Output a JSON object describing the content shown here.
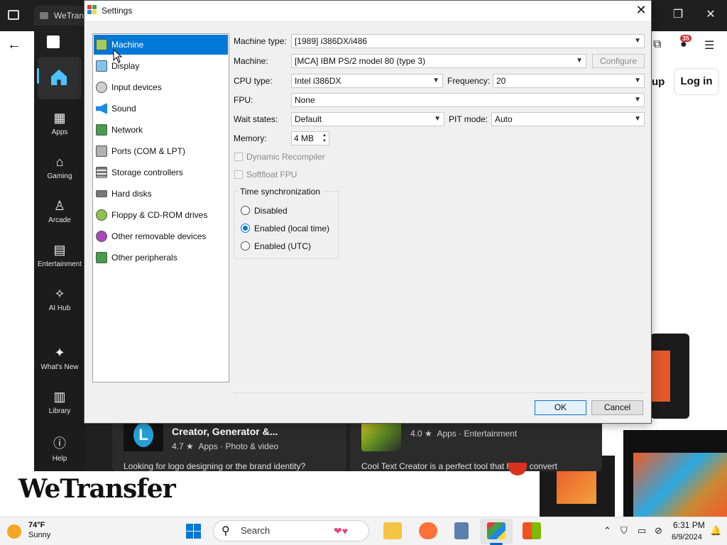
{
  "background": {
    "browser_tab_title": "WeTran",
    "signup_fragment": "up",
    "login_label": "Log in",
    "wetransfer_logo": "WeTransfer",
    "notification_count": "35",
    "store_sidebar": [
      {
        "label": "Apps",
        "icon": "apps-icon"
      },
      {
        "label": "Gaming",
        "icon": "gamepad-icon"
      },
      {
        "label": "Arcade",
        "icon": "joystick-icon"
      },
      {
        "label": "Entertainment",
        "icon": "clapper-icon"
      },
      {
        "label": "AI Hub",
        "icon": "sparkle-icon"
      },
      {
        "label": "What's New",
        "icon": "megaphone-icon"
      },
      {
        "label": "Library",
        "icon": "library-icon"
      },
      {
        "label": "Help",
        "icon": "help-icon"
      }
    ],
    "card1": {
      "title": "Creator, Generator &...",
      "rating": "4.7 ★",
      "category": "Apps",
      "subcategory": "Photo & video",
      "description": "Looking for logo designing or the brand identity?"
    },
    "card2": {
      "rating": "4.0 ★",
      "category": "Apps",
      "subcategory": "Entertainment",
      "description": "Cool Text Creator is a perfect tool that helps convert"
    }
  },
  "dialog": {
    "title": "Settings",
    "categories": [
      {
        "label": "Machine",
        "icon": "machine-icon",
        "selected": true
      },
      {
        "label": "Display",
        "icon": "display-icon"
      },
      {
        "label": "Input devices",
        "icon": "input-devices-icon"
      },
      {
        "label": "Sound",
        "icon": "speaker-icon"
      },
      {
        "label": "Network",
        "icon": "network-icon"
      },
      {
        "label": "Ports (COM & LPT)",
        "icon": "ports-icon"
      },
      {
        "label": "Storage controllers",
        "icon": "storage-icon"
      },
      {
        "label": "Hard disks",
        "icon": "hard-disk-icon"
      },
      {
        "label": "Floppy & CD-ROM drives",
        "icon": "floppy-icon"
      },
      {
        "label": "Other removable devices",
        "icon": "removable-icon"
      },
      {
        "label": "Other peripherals",
        "icon": "peripherals-icon"
      }
    ],
    "machine_type": {
      "label": "Machine type:",
      "value": "[1989] i386DX/i486"
    },
    "machine": {
      "label": "Machine:",
      "value": "[MCA] IBM PS/2 model 80 (type 3)",
      "configure": "Configure"
    },
    "cpu_type": {
      "label": "CPU type:",
      "value": "Intel i386DX"
    },
    "frequency": {
      "label": "Frequency:",
      "value": "20"
    },
    "fpu": {
      "label": "FPU:",
      "value": "None"
    },
    "wait_states": {
      "label": "Wait states:",
      "value": "Default"
    },
    "pit_mode": {
      "label": "PIT mode:",
      "value": "Auto"
    },
    "memory": {
      "label": "Memory:",
      "value": "4 MB"
    },
    "dynamic_recompiler": {
      "label": "Dynamic Recompiler",
      "checked": false,
      "enabled": false
    },
    "softfloat_fpu": {
      "label": "Softfloat FPU",
      "checked": false,
      "enabled": false
    },
    "time_sync": {
      "title": "Time synchronization",
      "options": [
        {
          "label": "Disabled",
          "checked": false
        },
        {
          "label": "Enabled (local time)",
          "checked": true
        },
        {
          "label": "Enabled (UTC)",
          "checked": false
        }
      ]
    },
    "ok": "OK",
    "cancel": "Cancel"
  },
  "taskbar": {
    "temperature": "74°F",
    "condition": "Sunny",
    "search_label": "Search",
    "time": "6:31 PM",
    "date": "6/9/2024"
  }
}
